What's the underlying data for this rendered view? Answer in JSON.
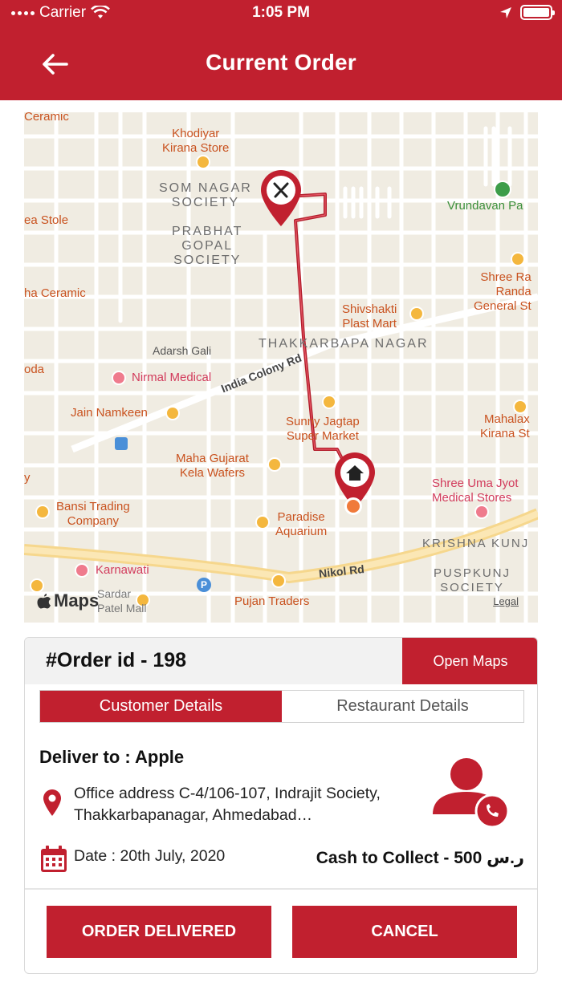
{
  "status_bar": {
    "carrier": "Carrier",
    "time": "1:05 PM"
  },
  "header": {
    "title": "Current Order"
  },
  "map": {
    "labels": {
      "ceramic_top": "Ceramic",
      "khodiyar": "Khodiyar\nKirana Store",
      "som_nagar": "SOM NAGAR\nSOCIETY",
      "prabhat": "PRABHAT\nGOPAL\nSOCIETY",
      "stole": "ea Stole",
      "vrundavan": "Vrundavan Pa",
      "shree_randa": "Shree Ra\nRanda\nGeneral St",
      "ha_ceramic": "ha Ceramic",
      "shivshakti": "Shivshakti\nPlast Mart",
      "adarsh": "Adarsh Gali",
      "thakkarbapa": "THAKKARBAPA NAGAR",
      "oda": "oda",
      "nirmal": "Nirmal Medical",
      "india_colony": "India Colony Rd",
      "jain": "Jain Namkeen",
      "sunny": "Sunny Jagtap\nSuper Market",
      "mahalax": "Mahalax\nKirana St",
      "maha_gujarat": "Maha Gujarat\nKela Wafers",
      "y": "y",
      "bansi": "Bansi Trading\nCompany",
      "shree_uma": "Shree Uma Jyot\nMedical Stores",
      "paradise": "Paradise\nAquarium",
      "krishna": "KRISHNA KUNJ",
      "karnawati": "Karnawati",
      "nikol": "Nikol Rd",
      "puspkunj": "PUSPKUNJ\nSOCIETY",
      "sardar": "Sardar\nPatel Mall",
      "pujan": "Pujan Traders"
    },
    "maps_logo": "Maps",
    "legal": "Legal"
  },
  "order": {
    "id_label": "#Order id - 198",
    "open_maps": "Open Maps",
    "tabs": [
      {
        "label": "Customer Details",
        "active": true
      },
      {
        "label": "Restaurant Details",
        "active": false
      }
    ],
    "deliver_to": "Deliver to :  Apple",
    "address": "Office address C-4/106-107, Indrajit Society, Thakkarbapanagar, Ahmedabad…",
    "date": "Date : 20th July, 2020",
    "cash": "Cash to Collect - 500 ر.س",
    "btn_delivered": "ORDER DELIVERED",
    "btn_cancel": "CANCEL"
  },
  "colors": {
    "brand_red": "#c1202f"
  }
}
